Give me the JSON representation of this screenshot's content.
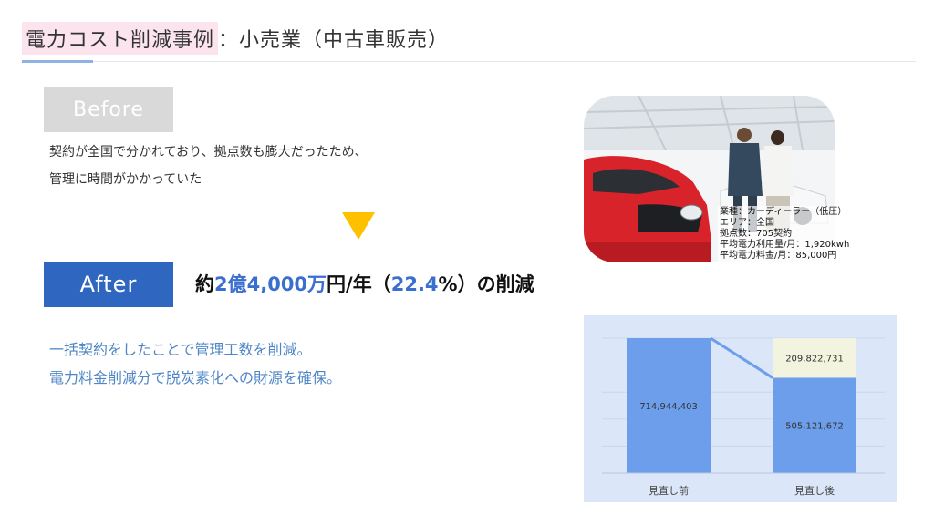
{
  "title": {
    "highlight": "電力コスト削減事例",
    "rest": "：小売業（中古車販売）"
  },
  "before": {
    "label": "Before",
    "lines": [
      "契約が全国で分かれており、拠点数も膨大だったため、",
      "管理に時間がかかっていた"
    ]
  },
  "after": {
    "label": "After",
    "headline": {
      "p1": "約",
      "n1": "2億4,000万",
      "p2": "円/年（",
      "n2": "22.4",
      "p3": "%）の削減"
    },
    "lines": [
      "一括契約をしたことで管理工数を削減。",
      "電力料金削減分で脱炭素化への財源を確保。"
    ]
  },
  "photo_info": {
    "lines": [
      "業種：カーディーラー（低圧）",
      "エリア：全国",
      "拠点数：705契約",
      "平均電力利用量/月：1,920kwh",
      "平均電力料金/月：85,000円"
    ]
  },
  "colors": {
    "accent_blue": "#2e66c0",
    "highlight_pink": "#fbe4ee",
    "arrow_yellow": "#ffc000",
    "bar_blue": "#6d9eeb",
    "saving_fill": "#f2f4df",
    "chart_bg": "#dbe6f8"
  },
  "chart_data": {
    "type": "bar",
    "stacked": true,
    "categories": [
      "見直し前",
      "見直し後"
    ],
    "series": [
      {
        "values": [
          714944403,
          505121672
        ],
        "labels": [
          "714,944,403",
          "505,121,672"
        ],
        "color": "#6d9eeb"
      },
      {
        "values": [
          0,
          209822731
        ],
        "labels": [
          "",
          "209,822,731"
        ],
        "color": "#f2f4df"
      }
    ],
    "connector": true,
    "ylim": [
      0,
      714944403
    ],
    "grid": true,
    "legend": "none"
  }
}
